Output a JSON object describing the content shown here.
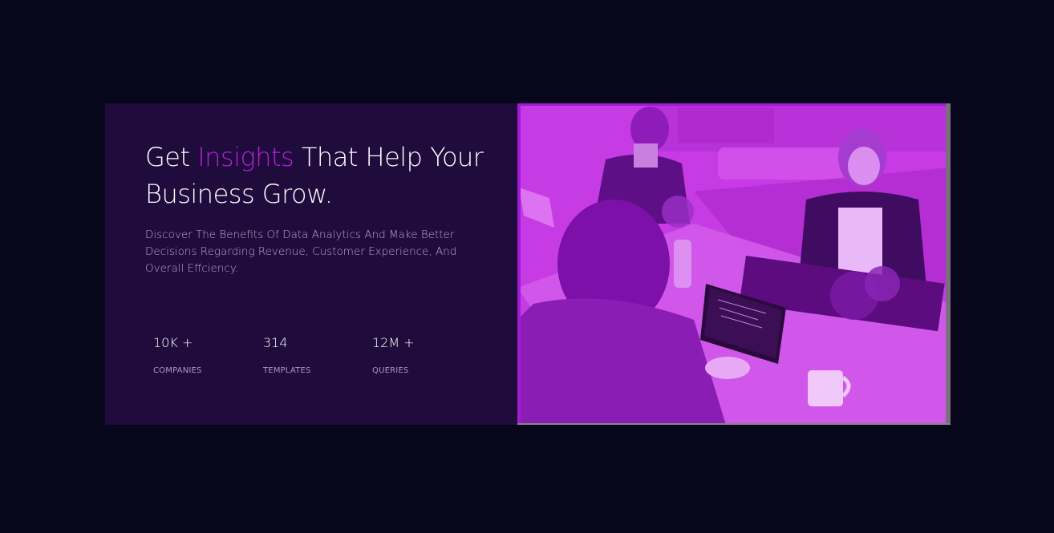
{
  "hero": {
    "headline_part1": "Get ",
    "headline_accent": "Insights",
    "headline_part2": " That Help Your Business Grow.",
    "description": "Discover The Benefits Of Data Analytics And Make Better Decisions Regarding Revenue, Customer Experience, And Overall Effciency."
  },
  "stats": [
    {
      "value": "10K +",
      "label": "COMPANIES"
    },
    {
      "value": "314",
      "label": "TEMPLATES"
    },
    {
      "value": "12M +",
      "label": "QUERIES"
    }
  ],
  "colors": {
    "page_background": "#08061a",
    "panel_background": "#1f0b3c",
    "accent": "#b61fd9",
    "photo_tint": "#c63be4"
  },
  "image": {
    "subject": "team-meeting-photo"
  }
}
